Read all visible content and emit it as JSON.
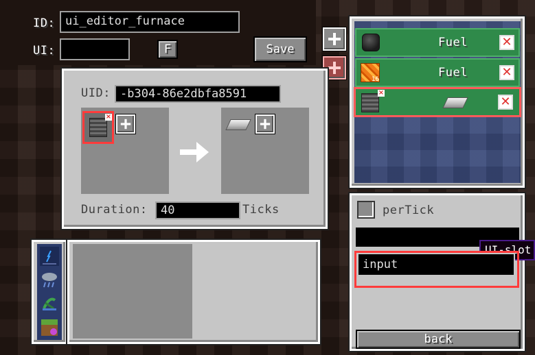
{
  "editor": {
    "id_label": "ID:",
    "id_value": "ui_editor_furnace",
    "ui_label": "UI:",
    "ui_value": "",
    "f_button": "F",
    "save_button": "Save"
  },
  "recipe": {
    "uid_label": "UID:",
    "uid_value": "-b304-86e2dbfa8591",
    "duration_label": "Duration:",
    "duration_value": "40",
    "duration_unit": "Ticks"
  },
  "fuel_list": {
    "items": [
      {
        "icon": "coal-icon",
        "label": "Fuel"
      },
      {
        "icon": "lava-bucket-icon",
        "label": "Fuel",
        "count": "16"
      },
      {
        "icon": "furnace-block-icon",
        "label": "",
        "output_icon": "iron-ingot-icon"
      }
    ]
  },
  "slot_panel": {
    "per_tick_label": "perTick",
    "slot_field_value": "",
    "tooltip": "UI-slot",
    "input_value": "input",
    "back_button": "back"
  },
  "colors": {
    "panel": "#c6c6c6",
    "highlight": "#ff3b3b",
    "list_bg": "#3b4a7a",
    "row_green": "#2f8a4a"
  }
}
